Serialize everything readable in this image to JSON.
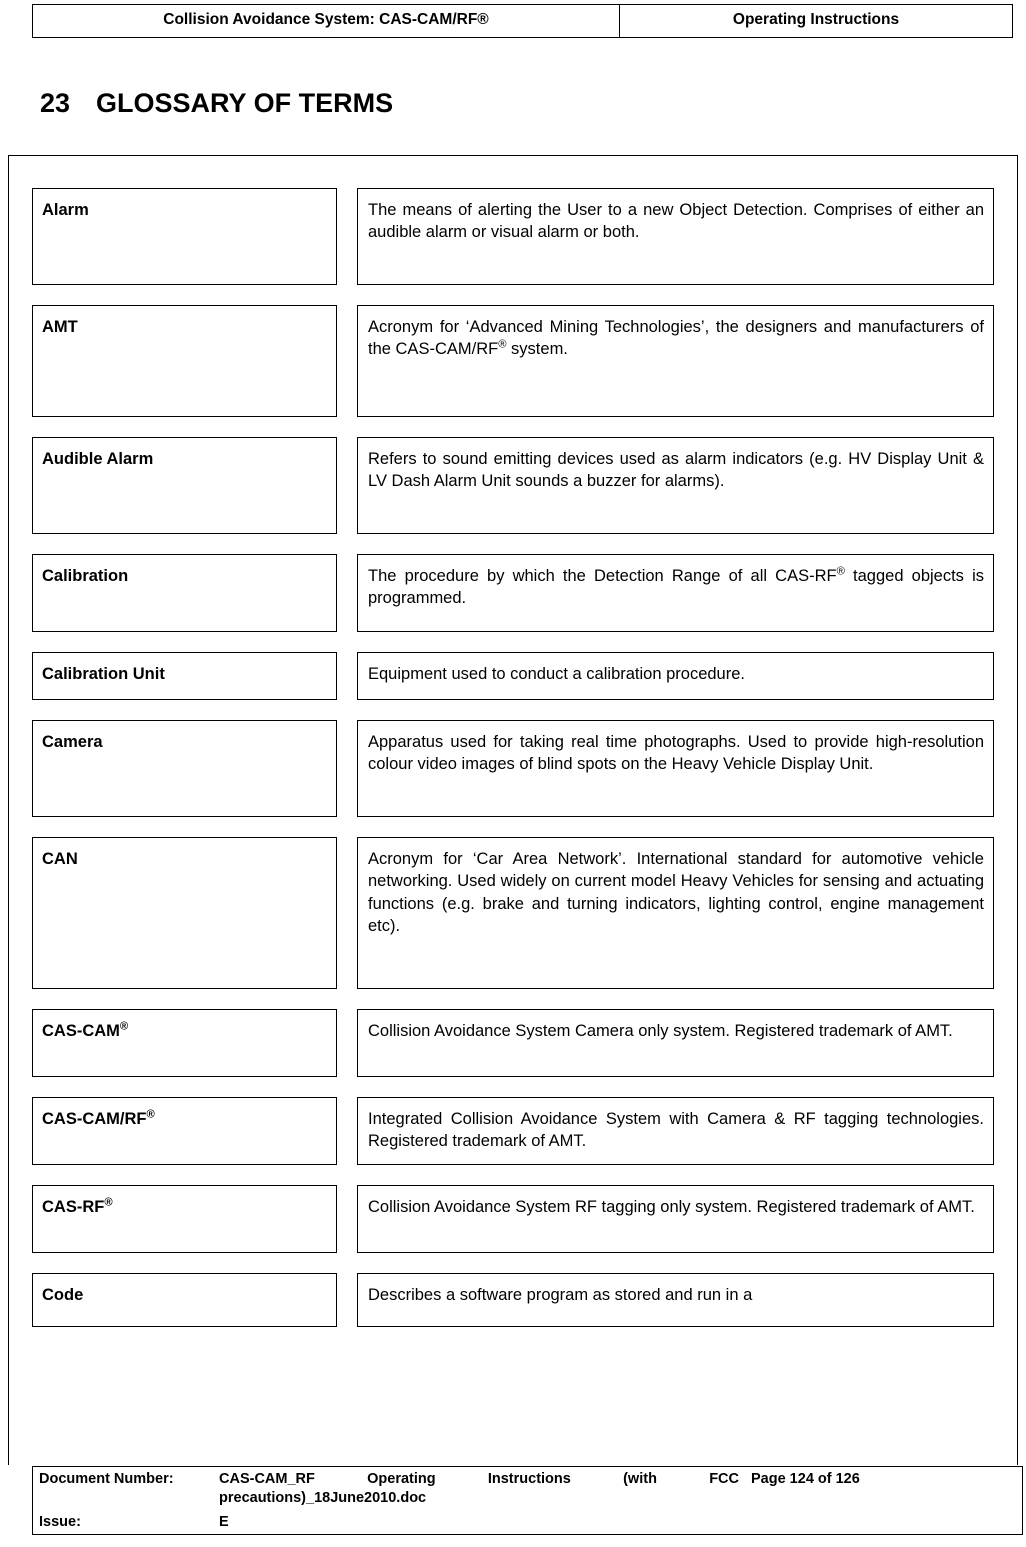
{
  "header": {
    "left": "Collision Avoidance System: CAS-CAM/RF®",
    "right": "Operating Instructions"
  },
  "title": {
    "number": "23",
    "text": "GLOSSARY OF TERMS"
  },
  "glossary": [
    {
      "term": "Alarm",
      "definition": "The means of alerting the User to a new Object Detection. Comprises of either an audible alarm or visual alarm or both.",
      "term_html": "Alarm",
      "def_html": "The means of alerting the User to a new Object Detection. Comprises of either an audible alarm or visual alarm or both."
    },
    {
      "term": "AMT",
      "definition": "Acronym for ‘Advanced Mining Technologies’, the designers and manufacturers of the CAS-CAM/RF® system.",
      "term_html": "AMT",
      "def_html": "Acronym for ‘Advanced Mining Technologies’, the designers and manufacturers of the CAS-CAM/RF<sup>®</sup> system."
    },
    {
      "term": "Audible Alarm",
      "definition": "Refers to sound emitting devices used as alarm indicators (e.g. HV Display Unit & LV Dash Alarm Unit sounds a buzzer for alarms).",
      "term_html": "Audible Alarm",
      "def_html": "Refers to sound emitting devices used as alarm indicators (e.g. HV Display Unit &amp; LV Dash Alarm Unit sounds a buzzer for alarms)."
    },
    {
      "term": "Calibration",
      "definition": "The procedure by which the Detection Range of all CAS-RF® tagged objects is programmed.",
      "term_html": "Calibration",
      "def_html": "The procedure by which the Detection Range of all CAS-RF<sup>®</sup> tagged objects is programmed."
    },
    {
      "term": "Calibration Unit",
      "definition": "Equipment used to conduct a calibration procedure.",
      "term_html": "Calibration Unit",
      "def_html": "Equipment used to conduct a calibration procedure."
    },
    {
      "term": "Camera",
      "definition": "Apparatus used for taking real time photographs. Used to provide high-resolution colour video images of blind spots on the Heavy Vehicle Display Unit.",
      "term_html": "Camera",
      "def_html": "Apparatus used for taking real time photographs. Used to provide high-resolution colour video images of blind spots on the Heavy Vehicle Display Unit."
    },
    {
      "term": "CAN",
      "definition": "Acronym for ‘Car Area Network’. International standard for automotive vehicle networking. Used widely on current model Heavy Vehicles for sensing and actuating functions (e.g. brake and turning indicators, lighting control, engine management etc).",
      "term_html": "CAN",
      "def_html": "Acronym for ‘Car Area Network’. International standard for automotive vehicle networking. Used widely on current model Heavy Vehicles for sensing and actuating functions (e.g. brake and turning indicators, lighting control, engine management etc)."
    },
    {
      "term": "CAS-CAM®",
      "definition": "Collision Avoidance System Camera only system. Registered trademark of AMT.",
      "term_html": "CAS-CAM<sup>®</sup>",
      "def_html": "Collision Avoidance System Camera only system. Registered trademark of AMT."
    },
    {
      "term": "CAS-CAM/RF®",
      "definition": "Integrated Collision Avoidance System with Camera & RF tagging technologies. Registered trademark of AMT.",
      "term_html": "CAS-CAM/RF<sup>®</sup>",
      "def_html": "Integrated Collision Avoidance System with Camera &amp; RF tagging technologies. Registered trademark of AMT."
    },
    {
      "term": "CAS-RF®",
      "definition": "Collision Avoidance System RF tagging only system. Registered trademark of AMT.",
      "term_html": "CAS-RF<sup>®</sup>",
      "def_html": "Collision Avoidance System RF tagging only system. Registered trademark of AMT."
    },
    {
      "term": "Code",
      "definition": "Describes a software program as stored and run in a",
      "term_html": "Code",
      "def_html": "Describes a software program as stored and run in a"
    }
  ],
  "footer": {
    "document_number_label": "Document Number:",
    "document_number_value": "CAS-CAM_RF Operating Instructions (with FCC precautions)_18June2010.doc",
    "page_value": "Page 124 of  126",
    "issue_label": "Issue:",
    "issue_value": "E"
  }
}
